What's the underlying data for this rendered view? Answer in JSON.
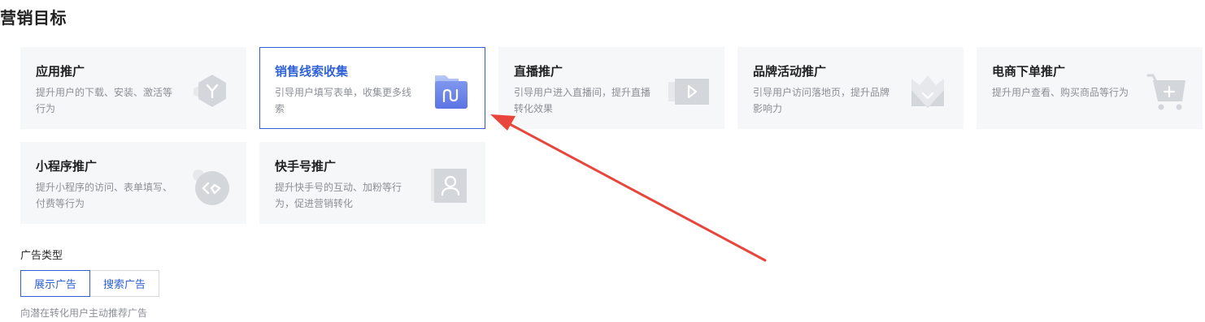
{
  "section_title": "营销目标",
  "cards": [
    {
      "title": "应用推广",
      "desc": "提升用户的下载、安装、激活等行为",
      "icon": "app-hexagon-icon",
      "selected": false
    },
    {
      "title": "销售线索收集",
      "desc": "引导用户填写表单，收集更多线索",
      "icon": "folder-icon",
      "selected": true
    },
    {
      "title": "直播推广",
      "desc": "引导用户进入直播间，提升直播转化效果",
      "icon": "video-play-icon",
      "selected": false
    },
    {
      "title": "品牌活动推广",
      "desc": "引导用户访问落地页，提升品牌影响力",
      "icon": "crown-icon",
      "selected": false
    },
    {
      "title": "电商下单推广",
      "desc": "提升用户查看、购买商品等行为",
      "icon": "shopping-cart-icon",
      "selected": false
    },
    {
      "title": "小程序推广",
      "desc": "提升小程序的访问、表单填写、付费等行为",
      "icon": "mini-program-icon",
      "selected": false
    },
    {
      "title": "快手号推广",
      "desc": "提升快手号的互动、加粉等行为，促进营销转化",
      "icon": "user-profile-icon",
      "selected": false
    }
  ],
  "ad_type": {
    "label": "广告类型",
    "tabs": [
      {
        "label": "展示广告",
        "active": true
      },
      {
        "label": "搜索广告",
        "active": false
      }
    ],
    "hint": "向潜在转化用户主动推荐广告"
  },
  "colors": {
    "accent": "#2f62d6",
    "card_bg": "#f6f7f9",
    "annotation_arrow": "#e8453c"
  }
}
